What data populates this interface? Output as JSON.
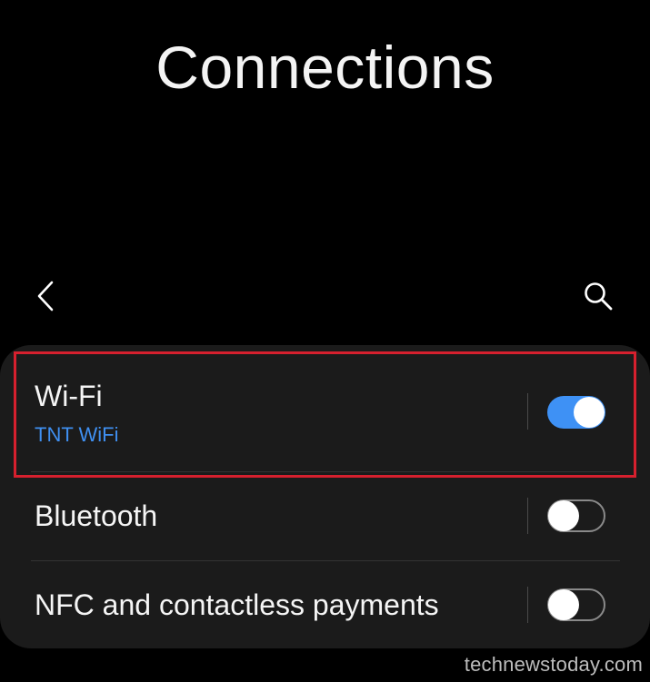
{
  "header": {
    "title": "Connections"
  },
  "nav": {
    "back_icon": "chevron-left-icon",
    "search_icon": "search-icon"
  },
  "settings": [
    {
      "title": "Wi-Fi",
      "subtitle": "TNT WiFi",
      "enabled": true
    },
    {
      "title": "Bluetooth",
      "enabled": false
    },
    {
      "title": "NFC and contactless payments",
      "enabled": false
    }
  ],
  "colors": {
    "accent": "#3e91f5",
    "highlight": "#d6202e",
    "card": "#1b1b1b",
    "background": "#000000"
  },
  "watermark": "technewstoday.com"
}
